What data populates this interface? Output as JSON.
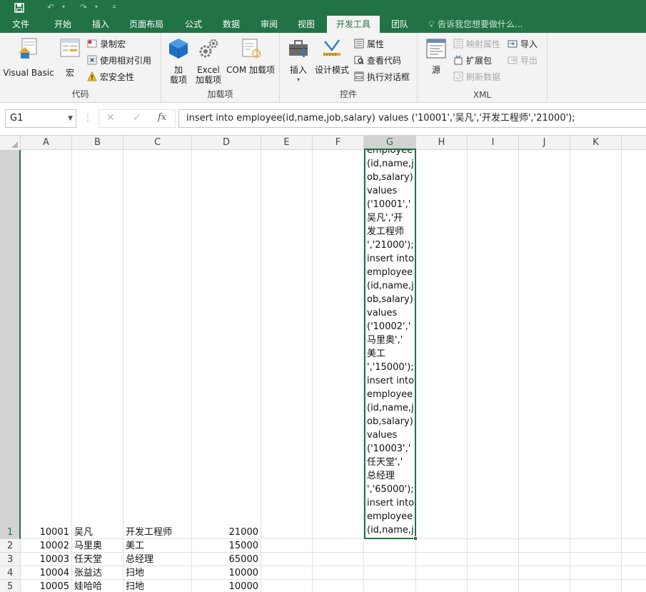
{
  "quick_access": {
    "save_icon": "save-icon",
    "undo_icon": "undo-icon",
    "redo_icon": "redo-icon",
    "customize_icon": "customize-icon"
  },
  "menu": {
    "tabs": [
      "文件",
      "开始",
      "插入",
      "页面布局",
      "公式",
      "数据",
      "审阅",
      "视图",
      "开发工具",
      "团队"
    ],
    "active_tab": "开发工具",
    "search_placeholder": "告诉我您想要做什么..."
  },
  "ribbon": {
    "code": {
      "label": "代码",
      "visual_basic": "Visual Basic",
      "macros": "宏",
      "record_macro": "录制宏",
      "relative_ref": "使用相对引用",
      "macro_security": "宏安全性"
    },
    "addins": {
      "label": "加载项",
      "addins_line1": "加",
      "addins_line2": "载项",
      "excel_addins_line1": "Excel",
      "excel_addins_line2": "加载项",
      "com_addins": "COM 加载项"
    },
    "controls": {
      "label": "控件",
      "insert": "插入",
      "design_mode": "设计模式",
      "properties": "属性",
      "view_code": "查看代码",
      "run_dialog": "执行对话框"
    },
    "xml": {
      "label": "XML",
      "source": "源",
      "map_properties": "映射属性",
      "expansion_packs": "扩展包",
      "refresh_data": "刷新数据",
      "import": "导入",
      "export": "导出"
    }
  },
  "formula_bar": {
    "name_box": "G1",
    "fx_label": "fx",
    "content": "insert into employee(id,name,job,salary) values ('10001','吴凡','开发工程师','21000');"
  },
  "sheet": {
    "columns": [
      "A",
      "B",
      "C",
      "D",
      "E",
      "F",
      "G",
      "H",
      "I",
      "J",
      "K"
    ],
    "selected_column": "G",
    "selected_row": "1",
    "row_numbers": [
      "1",
      "2",
      "3",
      "4",
      "5"
    ],
    "rows": [
      {
        "id": "10001",
        "name": "吴凡",
        "job": "开发工程师",
        "salary": "21000"
      },
      {
        "id": "10002",
        "name": "马里奥",
        "job": "美工",
        "salary": "15000"
      },
      {
        "id": "10003",
        "name": "任天堂",
        "job": "总经理",
        "salary": "65000"
      },
      {
        "id": "10004",
        "name": "张益达",
        "job": "扫地",
        "salary": "10000"
      },
      {
        "id": "10005",
        "name": "娃哈哈",
        "job": "扫地",
        "salary": "10000"
      }
    ],
    "g1_visible_lines": [
      "employee",
      "(id,name,j",
      "ob,salary)",
      "values",
      "('10001','",
      "吴凡','开",
      "发工程师",
      "','21000');",
      "insert into",
      "employee",
      "(id,name,j",
      "ob,salary)",
      "values",
      "('10002','",
      "马里奥','",
      "美工",
      "','15000');",
      "insert into",
      "employee",
      "(id,name,j",
      "ob,salary)",
      "values",
      "('10003','",
      "任天堂','",
      "总经理",
      "','65000');",
      "insert into",
      "employee",
      "(id,name,j"
    ]
  }
}
